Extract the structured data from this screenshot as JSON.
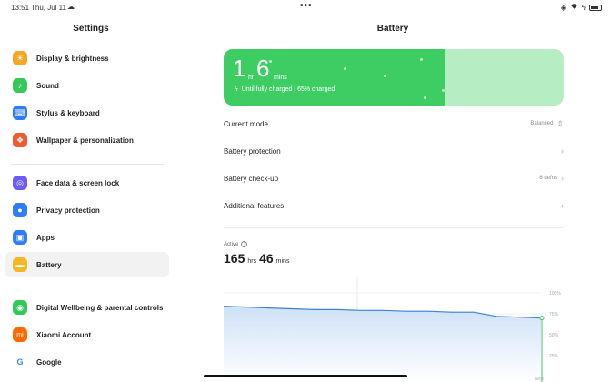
{
  "status": {
    "time": "13:51",
    "date": "Thu, Jul 11",
    "icons": [
      "cloud-icon",
      "wifi-icon",
      "battery-icon"
    ]
  },
  "left": {
    "title": "Settings",
    "items": [
      {
        "label": "Display & brightness",
        "icon": "sun-icon",
        "color": "#f5a623"
      },
      {
        "label": "Sound",
        "icon": "speaker-icon",
        "color": "#34c759"
      },
      {
        "label": "Stylus & keyboard",
        "icon": "keyboard-icon",
        "color": "#2f7cf6"
      },
      {
        "label": "Wallpaper & personalization",
        "icon": "wallpaper-icon",
        "color": "#ef5a2f"
      },
      {
        "label": "Face data & screen lock",
        "icon": "fingerprint-icon",
        "color": "#6b5cf6"
      },
      {
        "label": "Privacy protection",
        "icon": "privacy-icon",
        "color": "#2f7cf6"
      },
      {
        "label": "Apps",
        "icon": "apps-icon",
        "color": "#2f7cf6"
      },
      {
        "label": "Battery",
        "icon": "battery-icon",
        "color": "#f5b623"
      },
      {
        "label": "Digital Wellbeing & parental controls",
        "icon": "wellbeing-icon",
        "color": "#34c759"
      },
      {
        "label": "Xiaomi Account",
        "icon": "mi-icon",
        "color": "#ff6a00"
      },
      {
        "label": "Google",
        "icon": "google-icon",
        "color": "#ffffff"
      }
    ],
    "selected": "Battery"
  },
  "right": {
    "title": "Battery",
    "charge": {
      "hours": "1",
      "hours_unit": "hr",
      "mins": "6",
      "mins_unit": "mins",
      "subtitle": "Until fully charged | 65% charged",
      "percent": 65
    },
    "rows": [
      {
        "label": "Current mode",
        "value": "Balanced",
        "chevron": "⌃"
      },
      {
        "label": "Battery protection",
        "value": "",
        "chevron": "›"
      },
      {
        "label": "Battery check-up",
        "value": "6 defns",
        "chevron": "›"
      },
      {
        "label": "Additional features",
        "value": "",
        "chevron": "›"
      }
    ],
    "active": {
      "label": "Active",
      "hours": "165",
      "hours_unit": "hrs",
      "mins": "46",
      "mins_unit": "mins"
    }
  },
  "chart_data": {
    "type": "area",
    "y_ticks": [
      "100%",
      "75%",
      "50%",
      "25%"
    ],
    "x_end_label": "Now",
    "ylim": [
      0,
      100
    ],
    "x": [
      0,
      1,
      2,
      3,
      4,
      5,
      6,
      7,
      8,
      9,
      10,
      11,
      12,
      13,
      14
    ],
    "values": [
      84,
      83,
      82,
      81,
      80,
      80,
      79,
      79,
      78,
      78,
      77,
      77,
      72,
      71,
      70
    ],
    "color": "#3b82d6"
  }
}
